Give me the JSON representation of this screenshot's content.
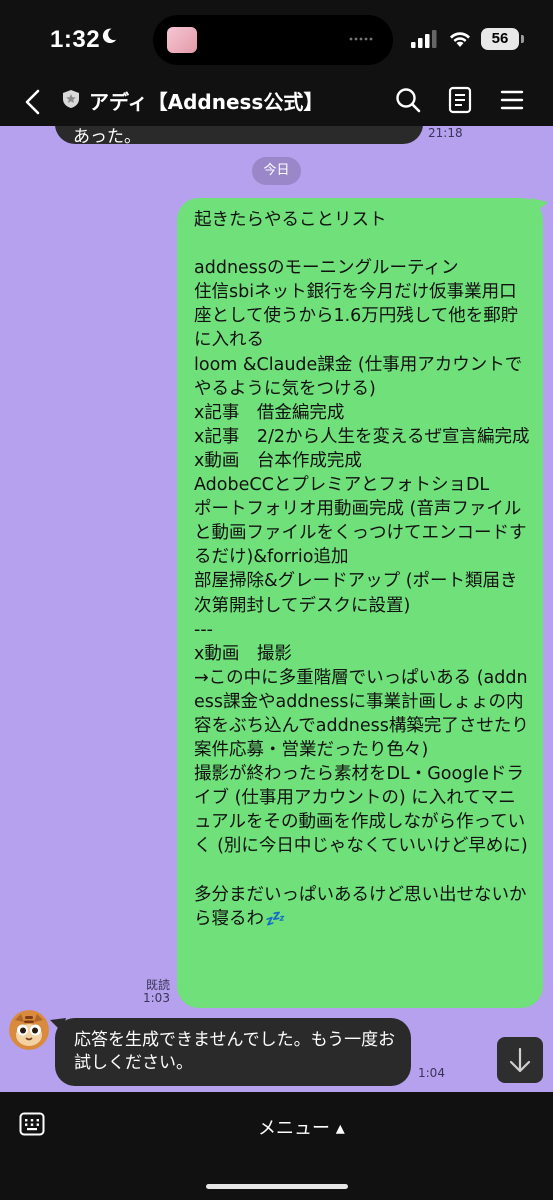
{
  "status_bar": {
    "time": "1:32",
    "battery": "56"
  },
  "header": {
    "title": "アディ【Addness公式】",
    "icons": [
      "back-icon",
      "shield-icon",
      "search-icon",
      "notes-icon",
      "menu-icon"
    ]
  },
  "chat": {
    "previous_message_fragment": "あった。",
    "previous_message_time": "21:18",
    "date_separator": "今日",
    "sent_message": {
      "text": "起きたらやることリスト\n\naddnessのモーニングルーティン\n住信sbiネット銀行を今月だけ仮事業用口座として使うから1.6万円残して他を郵貯に入れる\nloom &Claude課金 (仕事用アカウントでやるように気をつける)\nx記事　借金編完成\nx記事　2/2から人生を変えるぜ宣言編完成\nx動画　台本作成完成\nAdobeCCとプレミアとフォトショDL\nポートフォリオ用動画完成 (音声ファイルと動画ファイルをくっつけてエンコードするだけ)&forrio追加\n部屋掃除&グレードアップ (ポート類届き次第開封してデスクに設置)\n---\nx動画　撮影\n→この中に多重階層でいっぱいある (addness課金やaddnessに事業計画しょょの内容をぶち込んでaddness構築完了させたり案件応募・営業だったり色々)\n撮影が終わったら素材をDL・Googleドライブ (仕事用アカウントの) に入れてマニュアルをその動画を作成しながら作っていく (別に今日中じゃなくていいけど早めに)\n\n多分まだいっぱいあるけど思い出せないから寝るわ",
      "emoji": "💤",
      "read_label": "既読",
      "time": "1:03"
    },
    "received_message": {
      "text": "応答を生成できませんでした。もう一度お試しください。",
      "time": "1:04"
    }
  },
  "bottom_bar": {
    "menu_label": "メニュー ▴"
  },
  "colors": {
    "chat_background": "#b5a1ed",
    "sent_bubble": "#6fe07a",
    "received_bubble": "#2a2a2a",
    "bar_background": "#111111"
  }
}
